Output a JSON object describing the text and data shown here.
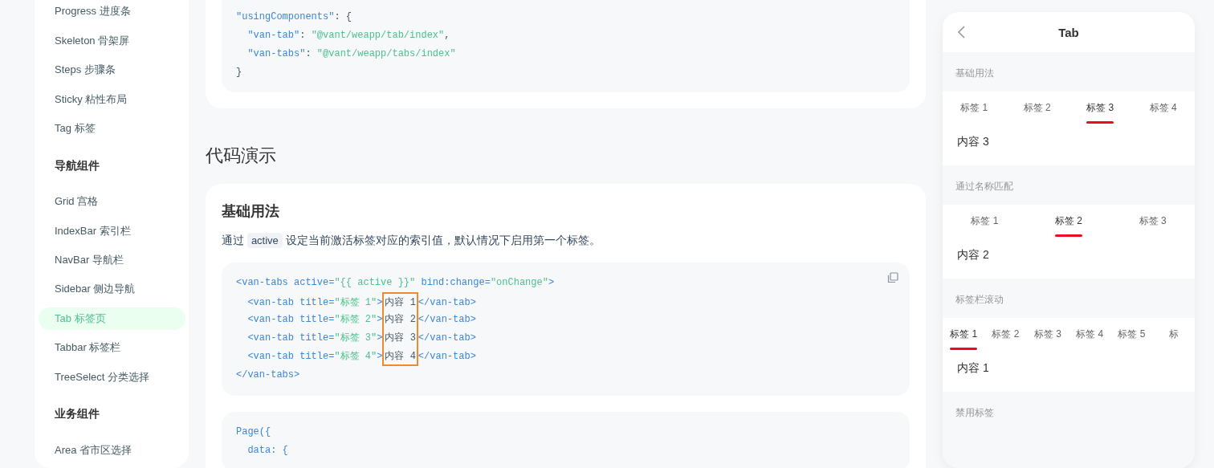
{
  "sidebar": {
    "items": [
      {
        "kind": "item",
        "label": "Progress 进度条",
        "selected": false
      },
      {
        "kind": "item",
        "label": "Skeleton 骨架屏",
        "selected": false
      },
      {
        "kind": "item",
        "label": "Steps 步骤条",
        "selected": false
      },
      {
        "kind": "item",
        "label": "Sticky 粘性布局",
        "selected": false
      },
      {
        "kind": "item",
        "label": "Tag 标签",
        "selected": false
      },
      {
        "kind": "group",
        "label": "导航组件"
      },
      {
        "kind": "item",
        "label": "Grid 宫格",
        "selected": false
      },
      {
        "kind": "item",
        "label": "IndexBar 索引栏",
        "selected": false
      },
      {
        "kind": "item",
        "label": "NavBar 导航栏",
        "selected": false
      },
      {
        "kind": "item",
        "label": "Sidebar 侧边导航",
        "selected": false
      },
      {
        "kind": "item",
        "label": "Tab 标签页",
        "selected": true
      },
      {
        "kind": "item",
        "label": "Tabbar 标签栏",
        "selected": false
      },
      {
        "kind": "item",
        "label": "TreeSelect 分类选择",
        "selected": false
      },
      {
        "kind": "group",
        "label": "业务组件"
      },
      {
        "kind": "item",
        "label": "Area 省市区选择",
        "selected": false
      }
    ]
  },
  "config_code": {
    "lines": [
      [
        {
          "text": "\"usingComponents\"",
          "kind": "key"
        },
        {
          "text": ": {",
          "kind": "plain"
        }
      ],
      [
        {
          "text": "  \"van-tab\"",
          "kind": "key"
        },
        {
          "text": ": ",
          "kind": "plain"
        },
        {
          "text": "\"@vant/weapp/tab/index\"",
          "kind": "string"
        },
        {
          "text": ",",
          "kind": "plain"
        }
      ],
      [
        {
          "text": "  \"van-tabs\"",
          "kind": "key"
        },
        {
          "text": ": ",
          "kind": "plain"
        },
        {
          "text": "\"@vant/weapp/tabs/index\"",
          "kind": "string"
        }
      ],
      [
        {
          "text": "}",
          "kind": "plain"
        }
      ]
    ]
  },
  "section_heading": "代码演示",
  "demo_card": {
    "title": "基础用法",
    "description": [
      {
        "text": "通过 ",
        "kind": "plain"
      },
      {
        "text": "active",
        "kind": "code"
      },
      {
        "text": " 设定当前激活标签对应的索引值，默认情况下启用第一个标签。",
        "kind": "plain"
      }
    ],
    "code_blocks": [
      {
        "copy_button": true,
        "lines": [
          [
            {
              "text": "<van-tabs active=",
              "kind": "tag"
            },
            {
              "text": "\"{{ active }}\"",
              "kind": "string"
            },
            {
              "text": " bind:change=",
              "kind": "tag"
            },
            {
              "text": "\"onChange\"",
              "kind": "string"
            },
            {
              "text": ">",
              "kind": "tag"
            }
          ],
          [
            {
              "text": "  <van-tab title=",
              "kind": "tag"
            },
            {
              "text": "\"标签 1\"",
              "kind": "string"
            },
            {
              "text": ">",
              "kind": "tag"
            },
            {
              "text": "内容 1",
              "kind": "plain",
              "boxed": true
            },
            {
              "text": "</van-tab>",
              "kind": "tag"
            }
          ],
          [
            {
              "text": "  <van-tab title=",
              "kind": "tag"
            },
            {
              "text": "\"标签 2\"",
              "kind": "string"
            },
            {
              "text": ">",
              "kind": "tag"
            },
            {
              "text": "内容 2",
              "kind": "plain",
              "boxed": true
            },
            {
              "text": "</van-tab>",
              "kind": "tag"
            }
          ],
          [
            {
              "text": "  <van-tab title=",
              "kind": "tag"
            },
            {
              "text": "\"标签 3\"",
              "kind": "string"
            },
            {
              "text": ">",
              "kind": "tag"
            },
            {
              "text": "内容 3",
              "kind": "plain",
              "boxed": true
            },
            {
              "text": "</van-tab>",
              "kind": "tag"
            }
          ],
          [
            {
              "text": "  <van-tab title=",
              "kind": "tag"
            },
            {
              "text": "\"标签 4\"",
              "kind": "string"
            },
            {
              "text": ">",
              "kind": "tag"
            },
            {
              "text": "内容 4",
              "kind": "plain",
              "boxed": true
            },
            {
              "text": "</van-tab>",
              "kind": "tag"
            }
          ],
          [
            {
              "text": "</van-tabs>",
              "kind": "tag"
            }
          ]
        ]
      },
      {
        "copy_button": false,
        "lines": [
          [
            {
              "text": "Page({",
              "kind": "tag"
            }
          ],
          [
            {
              "text": "  data: {",
              "kind": "tag"
            }
          ]
        ]
      }
    ]
  },
  "simulator": {
    "title": "Tab",
    "sections": [
      {
        "title": "基础用法",
        "tabs": [
          {
            "label": "标签 1",
            "selected": false
          },
          {
            "label": "标签 2",
            "selected": false
          },
          {
            "label": "标签 3",
            "selected": true
          },
          {
            "label": "标签 4",
            "selected": false
          }
        ],
        "content": "内容 3"
      },
      {
        "title": "通过名称匹配",
        "tabs": [
          {
            "label": "标签 1",
            "selected": false
          },
          {
            "label": "标签 2",
            "selected": true
          },
          {
            "label": "标签 3",
            "selected": false
          }
        ],
        "content": "内容 2"
      },
      {
        "title": "标签栏滚动",
        "tabs": [
          {
            "label": "标签 1",
            "selected": true
          },
          {
            "label": "标签 2",
            "selected": false
          },
          {
            "label": "标签 3",
            "selected": false
          },
          {
            "label": "标签 4",
            "selected": false
          },
          {
            "label": "标签 5",
            "selected": false
          },
          {
            "label": "标",
            "selected": false
          }
        ],
        "content": "内容 1"
      },
      {
        "title": "禁用标签"
      }
    ]
  }
}
